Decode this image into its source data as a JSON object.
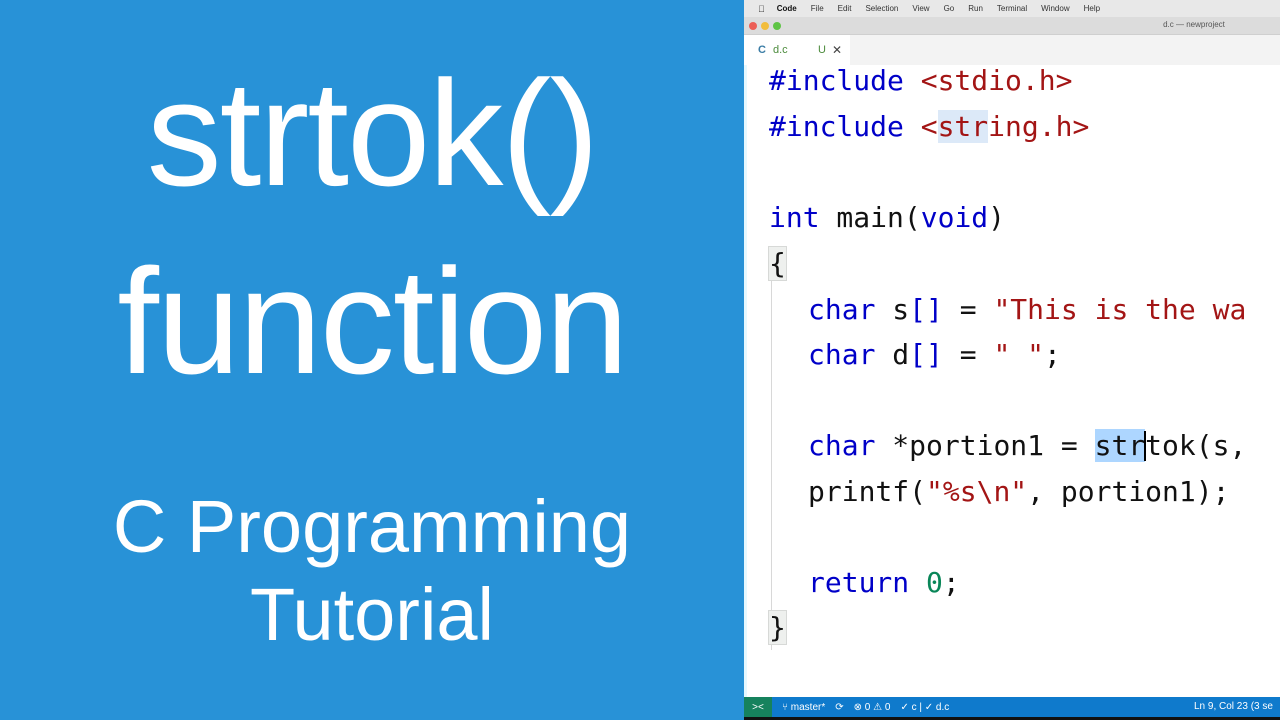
{
  "title_card": {
    "line1": "strtok()",
    "line2": "function",
    "line3": "C Programming",
    "line4": "Tutorial",
    "background_color": "#2892d7"
  },
  "menubar": {
    "apple_icon": "apple-logo",
    "items": [
      "Code",
      "File",
      "Edit",
      "Selection",
      "View",
      "Go",
      "Run",
      "Terminal",
      "Window",
      "Help"
    ]
  },
  "window": {
    "title": "d.c — newproject"
  },
  "tab": {
    "lang_icon": "C",
    "filename": "d.c",
    "status": "U",
    "close": "✕"
  },
  "code": {
    "line1": {
      "directive": "#include",
      "header": "<stdio.h>"
    },
    "line2": {
      "directive": "#include",
      "header_pre": "<",
      "header_sel": "str",
      "header_post": "ing.h>"
    },
    "line4": {
      "type": "int",
      "name": " main(",
      "param": "void",
      "close": ")"
    },
    "line5": "{",
    "line6": {
      "type": "char",
      "var": " s",
      "brackets": "[]",
      "eq": " = ",
      "value": "\"This is the wa"
    },
    "line7": {
      "type": "char",
      "var": " d",
      "brackets": "[]",
      "eq": " = ",
      "value": "\" \"",
      "end": ";"
    },
    "line9": {
      "type": "char",
      "decl": " *portion1 = ",
      "fn_sel": "str",
      "fn_rest": "tok(s, "
    },
    "line10": {
      "fn": "printf(",
      "fmt": "\"%s\\n\"",
      "rest": ", portion1);"
    },
    "line12": {
      "kw": "return",
      "sp": " ",
      "num": "0",
      "end": ";"
    },
    "line13": "}"
  },
  "statusbar": {
    "remote_icon": "><",
    "branch_icon": "⑂",
    "branch": "master*",
    "sync_icon": "⟳",
    "errors": "⊗ 0",
    "warnings": "⚠ 0",
    "checks": "✓ c | ✓ d.c",
    "position": "Ln 9, Col 23 (3 se"
  }
}
